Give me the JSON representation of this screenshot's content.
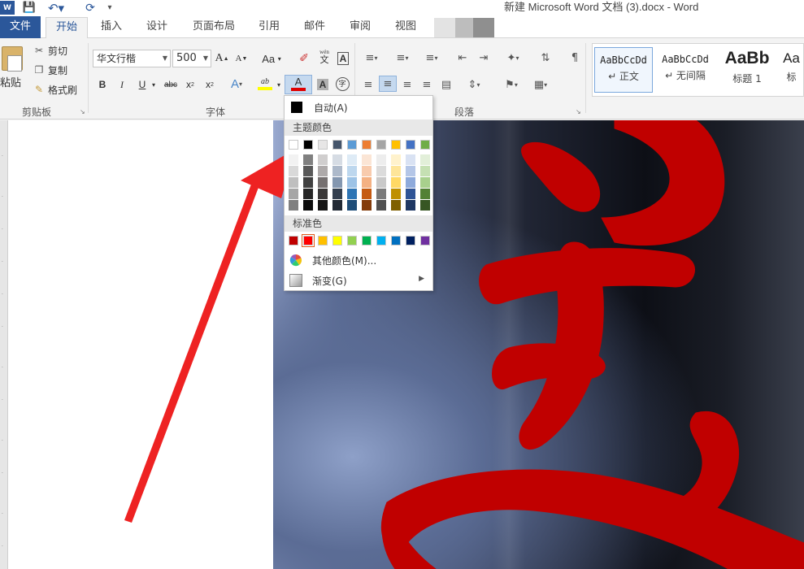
{
  "app": {
    "title": "新建 Microsoft Word 文档 (3).docx - Word",
    "logo_text": "W",
    "icons": {
      "save": "save-icon",
      "undo": "undo-icon",
      "redo": "redo-icon",
      "customize": "customize-qat-icon"
    }
  },
  "tabs": {
    "file": "文件",
    "home": "开始",
    "insert": "插入",
    "design": "设计",
    "layout": "页面布局",
    "references": "引用",
    "mailings": "邮件",
    "review": "审阅",
    "view": "视图"
  },
  "clipboard": {
    "paste": "粘贴",
    "cut": "剪切",
    "copy": "复制",
    "format_painter": "格式刷",
    "group_label": "剪贴板"
  },
  "font": {
    "name": "华文行楷",
    "size": "500",
    "grow": "A",
    "shrink": "A",
    "change_case": "Aa",
    "phonetic_top": "wén",
    "phonetic_bottom": "文",
    "border_char": "A",
    "bold": "B",
    "italic": "I",
    "underline": "U",
    "strike": "abc",
    "subscript": "x",
    "superscript": "x",
    "sub_mark": "2",
    "sup_mark": "2",
    "effects": "A",
    "highlight": "ab",
    "color_a": "A",
    "shading_a": "A",
    "enclose": "字",
    "group_label": "字体"
  },
  "paragraph": {
    "group_label": "段落"
  },
  "styles": {
    "items": [
      {
        "sample": "AaBbCcDd",
        "name": "↵ 正文"
      },
      {
        "sample": "AaBbCcDd",
        "name": "↵ 无间隔"
      },
      {
        "sample": "AaBb",
        "name": "标题 1"
      },
      {
        "sample": "Aa",
        "name": "标"
      }
    ]
  },
  "color_menu": {
    "auto_label": "自动(A)",
    "theme_header": "主题颜色",
    "standard_header": "标准色",
    "more_colors": "其他颜色(M)...",
    "gradient": "渐变(G)",
    "theme_colors": [
      "#ffffff",
      "#000000",
      "#e7e6e6",
      "#44546a",
      "#5b9bd5",
      "#ed7d31",
      "#a5a5a5",
      "#ffc000",
      "#4472c4",
      "#70ad47"
    ],
    "theme_shades": [
      [
        "#f2f2f2",
        "#d9d9d9",
        "#bfbfbf",
        "#a6a6a6",
        "#808080"
      ],
      [
        "#808080",
        "#595959",
        "#404040",
        "#262626",
        "#0d0d0d"
      ],
      [
        "#d0cece",
        "#aeaaaa",
        "#767171",
        "#3a3838",
        "#171616"
      ],
      [
        "#d6dce4",
        "#adb9ca",
        "#8497b0",
        "#333f4f",
        "#222a35"
      ],
      [
        "#deebf6",
        "#bdd7ee",
        "#9dc3e6",
        "#2e75b5",
        "#1f4e79"
      ],
      [
        "#fbe5d5",
        "#f8cbad",
        "#f4b183",
        "#c55a11",
        "#843c0b"
      ],
      [
        "#ededed",
        "#dbdbdb",
        "#c9c9c9",
        "#7b7b7b",
        "#525252"
      ],
      [
        "#fff2cc",
        "#fee599",
        "#ffd965",
        "#bf9000",
        "#7f6000"
      ],
      [
        "#d9e2f3",
        "#b4c6e7",
        "#8eaadb",
        "#2f5496",
        "#1f3864"
      ],
      [
        "#e2efd9",
        "#c5e0b3",
        "#a8d08d",
        "#538135",
        "#375623"
      ]
    ],
    "standard_colors": [
      "#c00000",
      "#ff0000",
      "#ffc000",
      "#ffff00",
      "#92d050",
      "#00b050",
      "#00b0f0",
      "#0070c0",
      "#002060",
      "#7030a0"
    ],
    "selected_standard_index": 1
  },
  "document": {
    "character": "美",
    "character_color": "#c00000",
    "arrow_color": "#ee2222"
  }
}
